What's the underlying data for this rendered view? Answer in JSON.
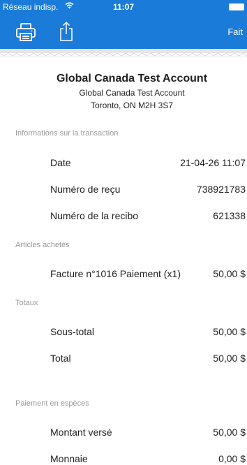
{
  "status_bar": {
    "carrier": "Réseau indisp.",
    "time": "11:07"
  },
  "toolbar": {
    "done_label": "Fait"
  },
  "receipt": {
    "merchant_name": "Global Canada Test Account",
    "merchant_line1": "Global Canada Test Account",
    "merchant_line2": "Toronto, ON M2H 3S7"
  },
  "sections": {
    "transaction": {
      "title": "Informations sur la transaction",
      "rows": [
        {
          "label": "Date",
          "value": "21-04-26 11:07"
        },
        {
          "label": "Numéro de reçu",
          "value": "738921783"
        },
        {
          "label": "Numéro de la recibo",
          "value": "621338"
        }
      ]
    },
    "items": {
      "title": "Articles achetés",
      "rows": [
        {
          "label": "Facture n°1016 Paiement (x1)",
          "value": "50,00 $"
        }
      ]
    },
    "totals": {
      "title": "Totaux",
      "rows": [
        {
          "label": "Sous-total",
          "value": "50,00 $"
        },
        {
          "label": "Total",
          "value": "50,00 $"
        }
      ]
    },
    "payment": {
      "title": "Paiement en espèces",
      "rows": [
        {
          "label": "Montant versé",
          "value": "50,00 $"
        },
        {
          "label": "Monnaie",
          "value": "0,00 $"
        }
      ]
    }
  },
  "colors": {
    "accent": "#1a7bd8",
    "section_title": "#9a9a9a"
  },
  "icons": {
    "print": "printer-icon",
    "share": "share-icon",
    "wifi": "wifi-icon",
    "battery": "battery-icon"
  }
}
